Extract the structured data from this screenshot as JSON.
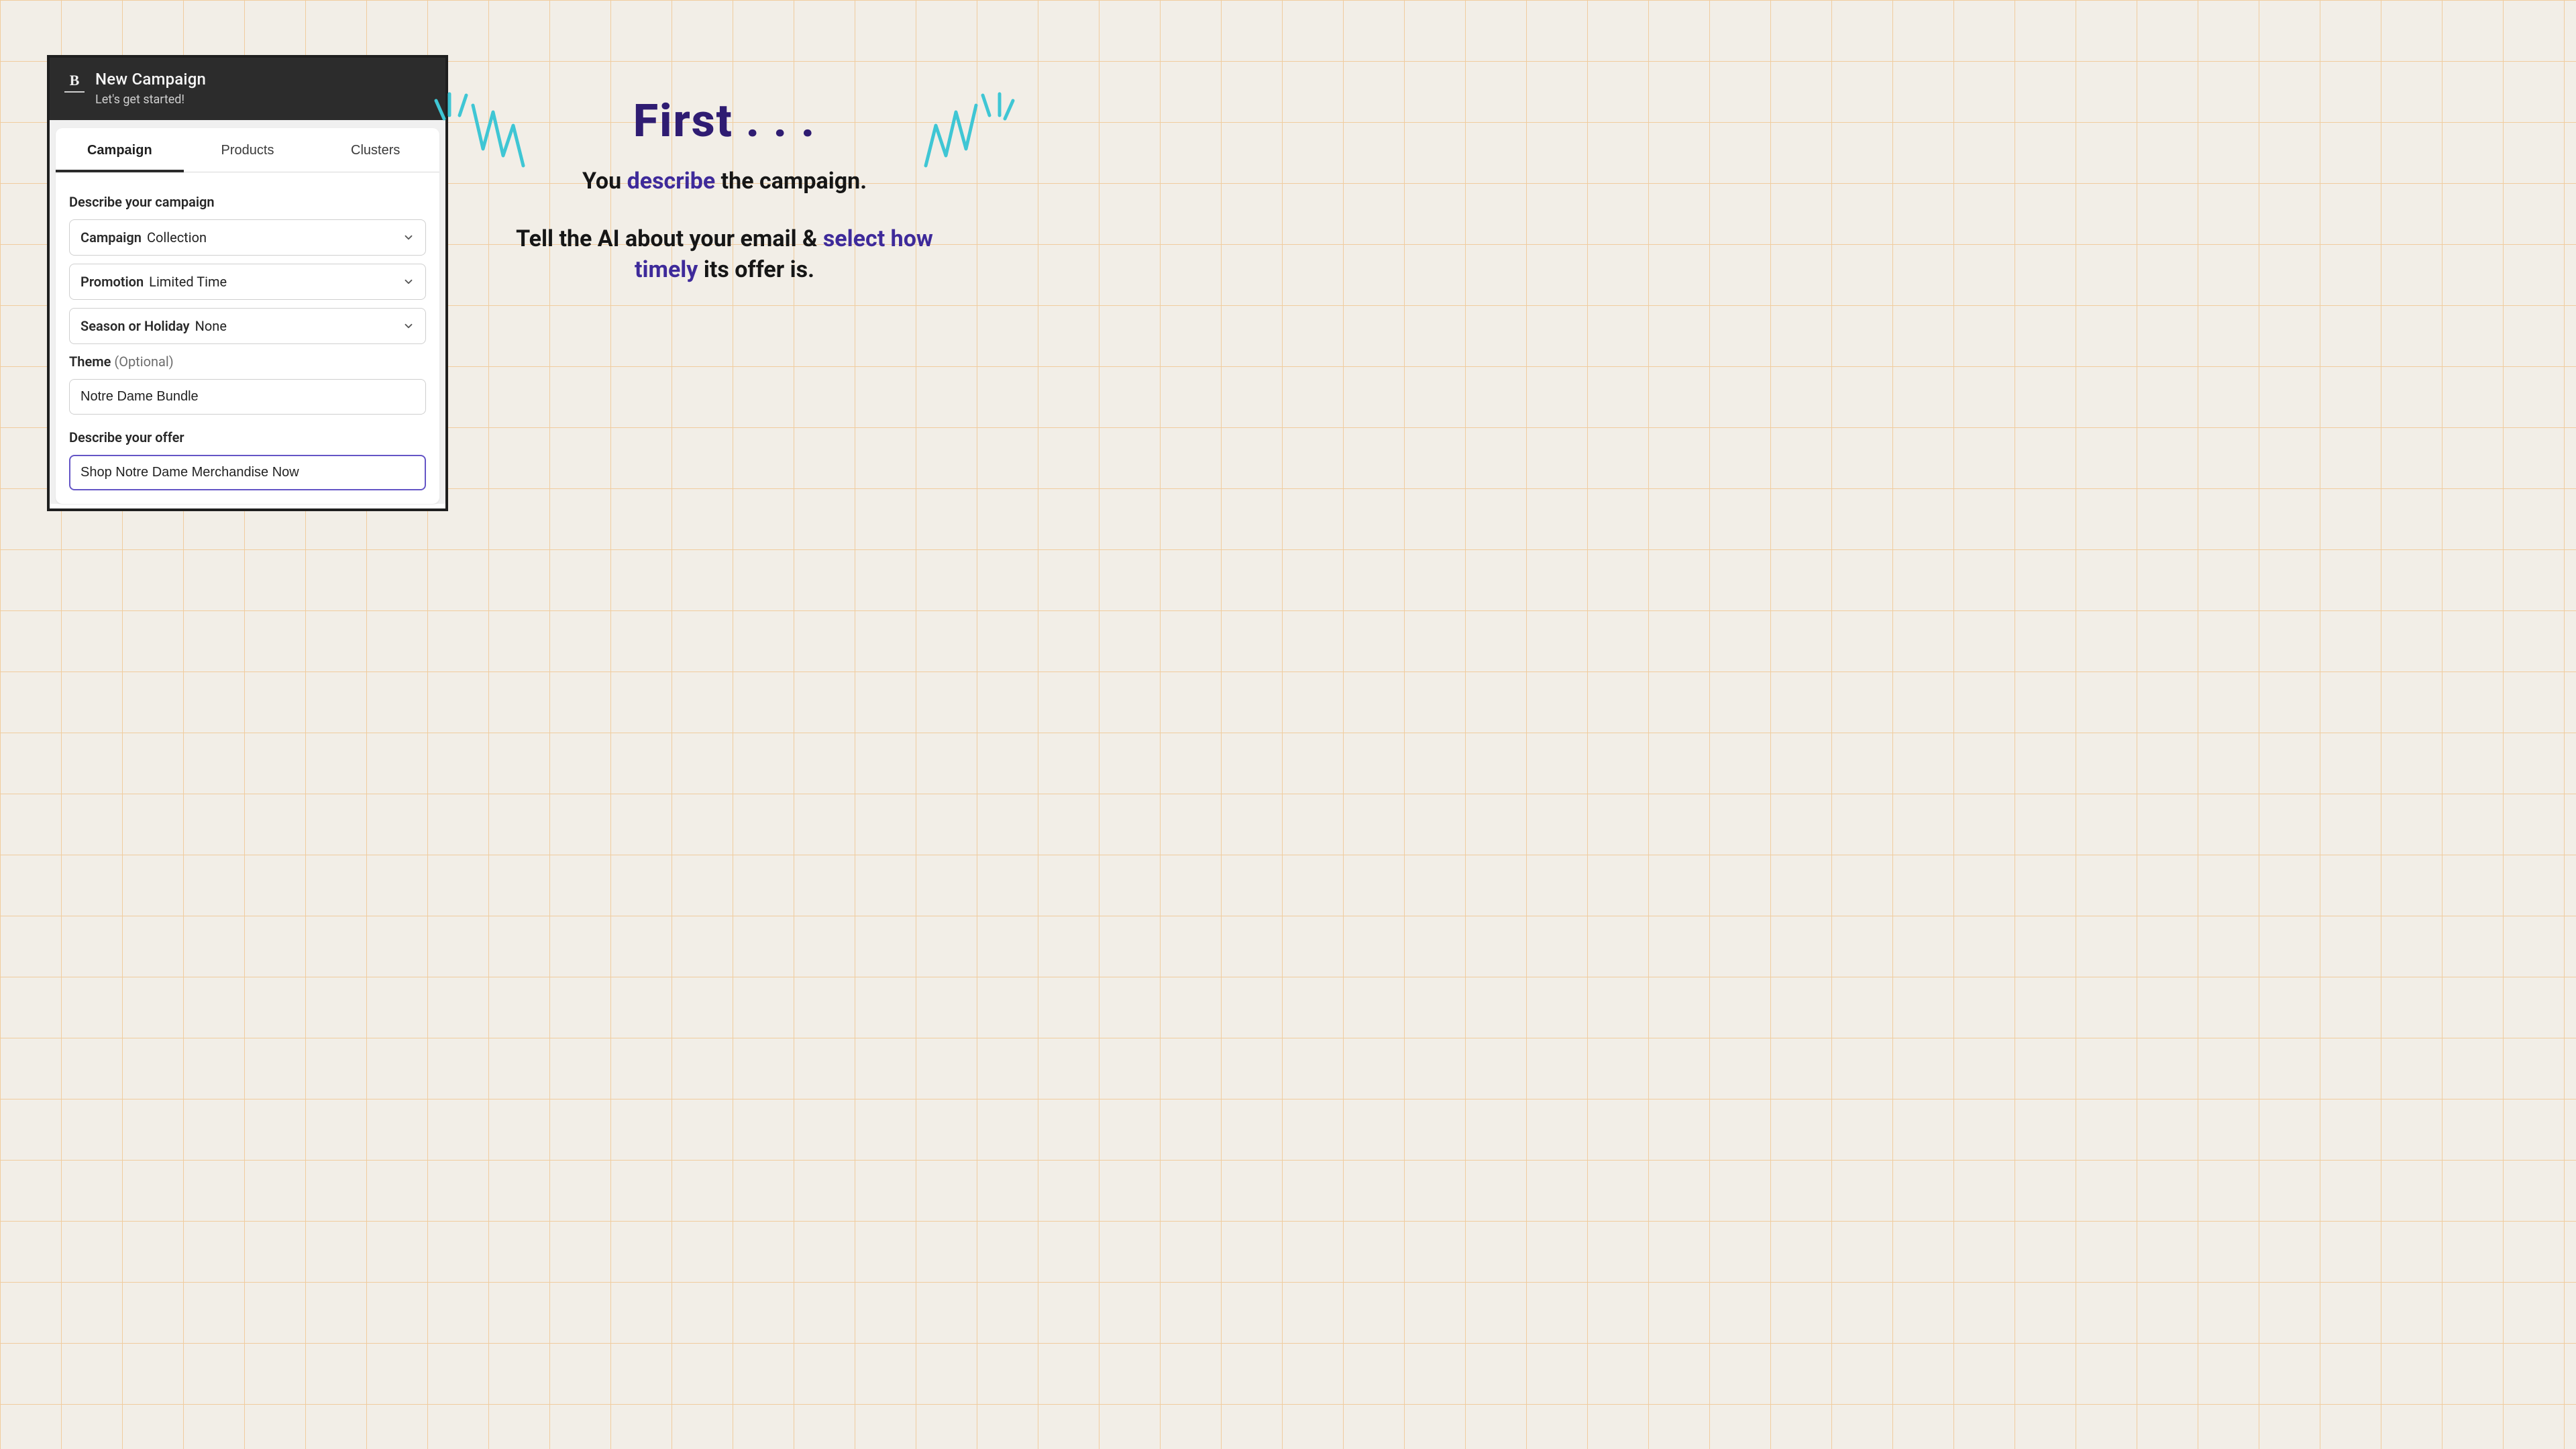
{
  "app": {
    "logo_letter": "B",
    "header_title": "New Campaign",
    "header_subtitle": "Let's get started!"
  },
  "tabs": [
    {
      "label": "Campaign",
      "active": true
    },
    {
      "label": "Products",
      "active": false
    },
    {
      "label": "Clusters",
      "active": false
    }
  ],
  "form": {
    "describe_campaign_label": "Describe your campaign",
    "selects": {
      "campaign": {
        "label": "Campaign",
        "value": "Collection"
      },
      "promotion": {
        "label": "Promotion",
        "value": "Limited Time"
      },
      "season": {
        "label": "Season or Holiday",
        "value": "None"
      }
    },
    "theme_label": "Theme",
    "theme_optional": "(Optional)",
    "theme_value": "Notre Dame Bundle",
    "offer_label": "Describe your offer",
    "offer_value": "Shop Notre Dame Merchandise Now"
  },
  "explainer": {
    "hero": "First . . .",
    "line1_pre": "You ",
    "line1_accent": "describe",
    "line1_post": " the campaign.",
    "line2_pre": "Tell the AI about your email & ",
    "line2_accent": "select how timely",
    "line2_post": " its offer is."
  },
  "colors": {
    "accent_purple": "#3e2a9a",
    "burst_teal": "#3fc6d4"
  }
}
